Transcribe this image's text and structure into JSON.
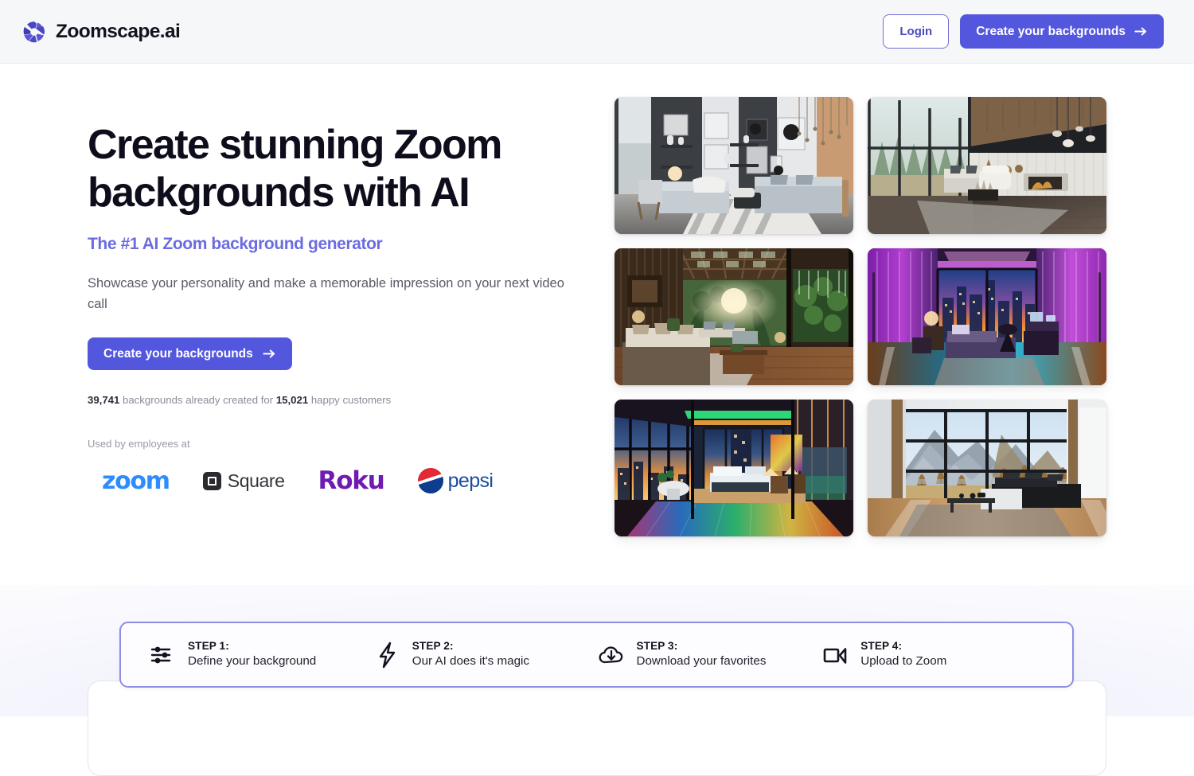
{
  "brand": {
    "name": "Zoomscape.ai",
    "logo_icon": "aperture-shutter-icon",
    "logo_color": "#4b46c4"
  },
  "header": {
    "login_label": "Login",
    "cta_label": "Create your backgrounds",
    "cta_icon": "arrow-right-icon",
    "cta_color": "#5357dd"
  },
  "hero": {
    "title": "Create stunning Zoom backgrounds with AI",
    "subtitle": "The #1 AI Zoom background generator",
    "description": "Showcase your personality and make a memorable impression on your next video call",
    "cta_label": "Create your backgrounds",
    "cta_icon": "arrow-right-icon",
    "stats": {
      "backgrounds_count": "39,741",
      "middle_text": "backgrounds already created for",
      "customers_count": "15,021",
      "trailing_text": "happy customers"
    },
    "social_proof_label": "Used by employees at",
    "brands": [
      {
        "name": "zoom",
        "color": "#2d8cff"
      },
      {
        "name": "Square",
        "color": "#34343a"
      },
      {
        "name": "Roku",
        "color": "#6f1ab1"
      },
      {
        "name": "pepsi",
        "color": "#1b4da0"
      }
    ]
  },
  "gallery": {
    "items": [
      {
        "alt": "Modern gray living room with gallery wall and pendant lights"
      },
      {
        "alt": "A-frame cabin lounge with floor-to-ceiling forest windows"
      },
      {
        "alt": "Tropical jungle lounge with wood beams and sunlight"
      },
      {
        "alt": "Neon purple bedroom with city skyline sunset view"
      },
      {
        "alt": "Rainbow neon penthouse bedroom overlooking the city"
      },
      {
        "alt": "Minimalist room with grid windows and autumn mountain valley"
      }
    ]
  },
  "steps": [
    {
      "num": "STEP 1:",
      "label": "Define your background",
      "icon": "sliders-icon"
    },
    {
      "num": "STEP 2:",
      "label": "Our AI does it's magic",
      "icon": "lightning-bolt-icon"
    },
    {
      "num": "STEP 3:",
      "label": "Download your favorites",
      "icon": "cloud-download-icon"
    },
    {
      "num": "STEP 4:",
      "label": "Upload to Zoom",
      "icon": "video-camera-icon"
    }
  ]
}
